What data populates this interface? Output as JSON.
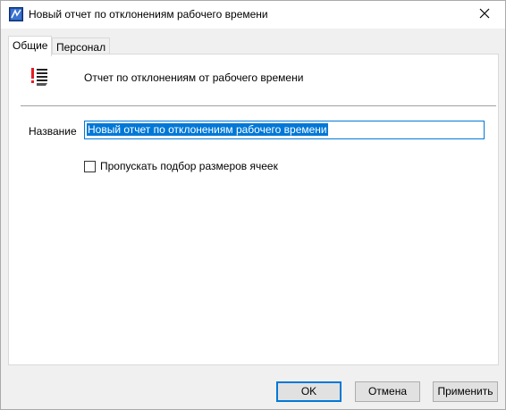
{
  "window": {
    "title": "Новый отчет по отклонениям рабочего времени"
  },
  "tabs": [
    {
      "label": "Общие",
      "active": true
    },
    {
      "label": "Персонал",
      "active": false
    }
  ],
  "general": {
    "description": "Отчет по отклонениям от рабочего времени",
    "name_label": "Название",
    "name_value": "Новый отчет по отклонениям рабочего времени",
    "skip_checkbox_label": "Пропускать подбор размеров ячеек",
    "skip_checkbox_checked": false
  },
  "buttons": {
    "ok": "OK",
    "cancel": "Отмена",
    "apply": "Применить"
  },
  "colors": {
    "accent": "#0078d7",
    "report_icon_red": "#e31e24"
  },
  "icons": {
    "app": "app-icon",
    "close": "close-icon",
    "report": "report-list-icon"
  }
}
